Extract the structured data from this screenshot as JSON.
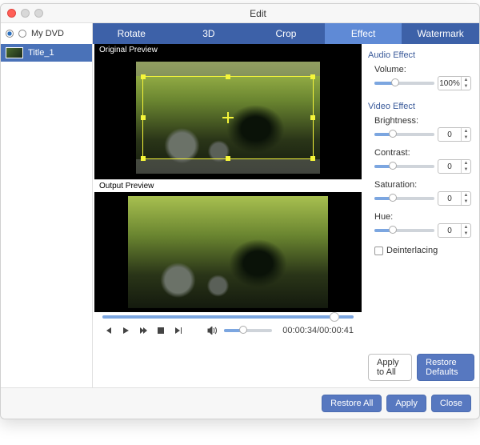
{
  "window": {
    "title": "Edit"
  },
  "source": {
    "label": "My DVD"
  },
  "sidebar": {
    "items": [
      {
        "title": "Title_1"
      }
    ]
  },
  "tabs": [
    {
      "id": "rotate",
      "label": "Rotate"
    },
    {
      "id": "3d",
      "label": "3D"
    },
    {
      "id": "crop",
      "label": "Crop"
    },
    {
      "id": "effect",
      "label": "Effect",
      "active": true
    },
    {
      "id": "watermark",
      "label": "Watermark"
    }
  ],
  "preview": {
    "original_label": "Original Preview",
    "output_label": "Output Preview",
    "time_current": "00:00:34",
    "time_total": "00:00:41"
  },
  "effects": {
    "audio_section": "Audio Effect",
    "volume_label": "Volume:",
    "volume_value": "100%",
    "video_section": "Video Effect",
    "brightness_label": "Brightness:",
    "brightness_value": "0",
    "contrast_label": "Contrast:",
    "contrast_value": "0",
    "saturation_label": "Saturation:",
    "saturation_value": "0",
    "hue_label": "Hue:",
    "hue_value": "0",
    "deinterlacing_label": "Deinterlacing"
  },
  "buttons": {
    "apply_all": "Apply to All",
    "restore_defaults": "Restore Defaults",
    "restore_all": "Restore All",
    "apply": "Apply",
    "close": "Close"
  },
  "icons": {
    "prev": "prev-icon",
    "play": "play-icon",
    "fwd": "forward-icon",
    "stop": "stop-icon",
    "next": "next-icon",
    "volume": "volume-icon"
  }
}
